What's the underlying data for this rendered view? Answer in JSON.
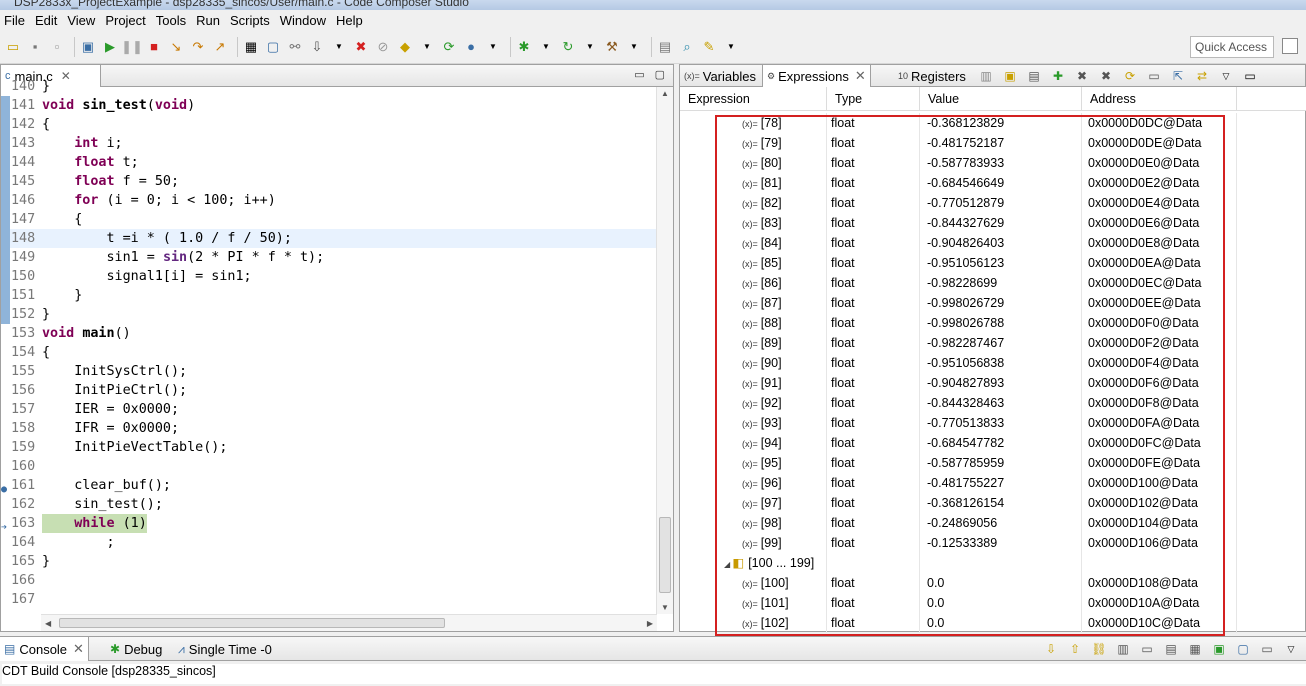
{
  "window": {
    "title": "DSP2833x_ProjectExample - dsp28335_sincos/User/main.c - Code Composer Studio"
  },
  "menu": [
    "File",
    "Edit",
    "View",
    "Project",
    "Tools",
    "Run",
    "Scripts",
    "Window",
    "Help"
  ],
  "toolbar": {
    "quick_access": "Quick Access"
  },
  "editor": {
    "tab_label": "main.c",
    "lines": [
      {
        "n": "140",
        "text": "}"
      },
      {
        "n": "141",
        "text": "void sin_test(void)"
      },
      {
        "n": "142",
        "text": "{"
      },
      {
        "n": "143",
        "text": "    int i;"
      },
      {
        "n": "144",
        "text": "    float t;"
      },
      {
        "n": "145",
        "text": "    float f = 50;"
      },
      {
        "n": "146",
        "text": "    for (i = 0; i < 100; i++)"
      },
      {
        "n": "147",
        "text": "    {"
      },
      {
        "n": "148",
        "text": "        t =i * ( 1.0 / f / 50);"
      },
      {
        "n": "149",
        "text": "        sin1 = sin(2 * PI * f * t);"
      },
      {
        "n": "150",
        "text": "        signal1[i] = sin1;"
      },
      {
        "n": "151",
        "text": "    }"
      },
      {
        "n": "152",
        "text": "}"
      },
      {
        "n": "153",
        "text": "void main()"
      },
      {
        "n": "154",
        "text": "{"
      },
      {
        "n": "155",
        "text": "    InitSysCtrl();"
      },
      {
        "n": "156",
        "text": "    InitPieCtrl();"
      },
      {
        "n": "157",
        "text": "    IER = 0x0000;"
      },
      {
        "n": "158",
        "text": "    IFR = 0x0000;"
      },
      {
        "n": "159",
        "text": "    InitPieVectTable();"
      },
      {
        "n": "160",
        "text": ""
      },
      {
        "n": "161",
        "text": "    clear_buf();"
      },
      {
        "n": "162",
        "text": "    sin_test();"
      },
      {
        "n": "163",
        "text": "    while (1)"
      },
      {
        "n": "164",
        "text": "        ;"
      },
      {
        "n": "165",
        "text": "}"
      },
      {
        "n": "166",
        "text": ""
      },
      {
        "n": "167",
        "text": ""
      }
    ]
  },
  "views": {
    "tabs": [
      "Variables",
      "Expressions",
      "Registers"
    ],
    "columns": [
      "Expression",
      "Type",
      "Value",
      "Address"
    ],
    "rows": [
      {
        "expr": "[78]",
        "type": "float",
        "value": "-0.368123829",
        "addr": "0x0000D0DC@Data"
      },
      {
        "expr": "[79]",
        "type": "float",
        "value": "-0.481752187",
        "addr": "0x0000D0DE@Data"
      },
      {
        "expr": "[80]",
        "type": "float",
        "value": "-0.587783933",
        "addr": "0x0000D0E0@Data"
      },
      {
        "expr": "[81]",
        "type": "float",
        "value": "-0.684546649",
        "addr": "0x0000D0E2@Data"
      },
      {
        "expr": "[82]",
        "type": "float",
        "value": "-0.770512879",
        "addr": "0x0000D0E4@Data"
      },
      {
        "expr": "[83]",
        "type": "float",
        "value": "-0.844327629",
        "addr": "0x0000D0E6@Data"
      },
      {
        "expr": "[84]",
        "type": "float",
        "value": "-0.904826403",
        "addr": "0x0000D0E8@Data"
      },
      {
        "expr": "[85]",
        "type": "float",
        "value": "-0.951056123",
        "addr": "0x0000D0EA@Data"
      },
      {
        "expr": "[86]",
        "type": "float",
        "value": "-0.98228699",
        "addr": "0x0000D0EC@Data"
      },
      {
        "expr": "[87]",
        "type": "float",
        "value": "-0.998026729",
        "addr": "0x0000D0EE@Data"
      },
      {
        "expr": "[88]",
        "type": "float",
        "value": "-0.998026788",
        "addr": "0x0000D0F0@Data"
      },
      {
        "expr": "[89]",
        "type": "float",
        "value": "-0.982287467",
        "addr": "0x0000D0F2@Data"
      },
      {
        "expr": "[90]",
        "type": "float",
        "value": "-0.951056838",
        "addr": "0x0000D0F4@Data"
      },
      {
        "expr": "[91]",
        "type": "float",
        "value": "-0.904827893",
        "addr": "0x0000D0F6@Data"
      },
      {
        "expr": "[92]",
        "type": "float",
        "value": "-0.844328463",
        "addr": "0x0000D0F8@Data"
      },
      {
        "expr": "[93]",
        "type": "float",
        "value": "-0.770513833",
        "addr": "0x0000D0FA@Data"
      },
      {
        "expr": "[94]",
        "type": "float",
        "value": "-0.684547782",
        "addr": "0x0000D0FC@Data"
      },
      {
        "expr": "[95]",
        "type": "float",
        "value": "-0.587785959",
        "addr": "0x0000D0FE@Data"
      },
      {
        "expr": "[96]",
        "type": "float",
        "value": "-0.481755227",
        "addr": "0x0000D100@Data"
      },
      {
        "expr": "[97]",
        "type": "float",
        "value": "-0.368126154",
        "addr": "0x0000D102@Data"
      },
      {
        "expr": "[98]",
        "type": "float",
        "value": "-0.24869056",
        "addr": "0x0000D104@Data"
      },
      {
        "expr": "[99]",
        "type": "float",
        "value": "-0.12533389",
        "addr": "0x0000D106@Data"
      },
      {
        "expr": "[100 ... 199]",
        "type": "",
        "value": "",
        "addr": "",
        "group": true
      },
      {
        "expr": "[100]",
        "type": "float",
        "value": "0.0",
        "addr": "0x0000D108@Data"
      },
      {
        "expr": "[101]",
        "type": "float",
        "value": "0.0",
        "addr": "0x0000D10A@Data"
      },
      {
        "expr": "[102]",
        "type": "float",
        "value": "0.0",
        "addr": "0x0000D10C@Data"
      }
    ]
  },
  "bottom": {
    "tabs": [
      "Console",
      "Debug",
      "Single Time -0"
    ],
    "console_text": "CDT Build Console [dsp28335_sincos]"
  }
}
